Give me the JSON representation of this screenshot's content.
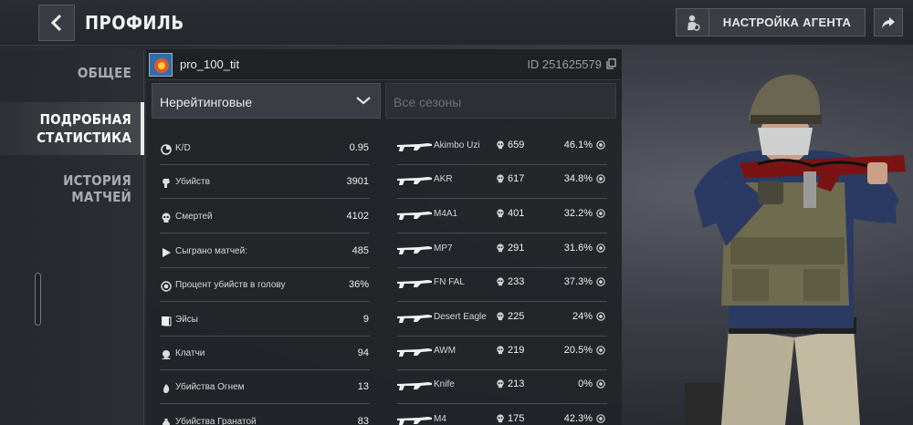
{
  "header": {
    "title": "ПРОФИЛЬ",
    "agent_button": "НАСТРОЙКА АГЕНТА"
  },
  "sidebar": {
    "items": [
      {
        "label": "ОБЩЕЕ",
        "active": false
      },
      {
        "label": "ПОДРОБНАЯ СТАТИСТИКА",
        "active": true
      },
      {
        "label": "ИСТОРИЯ МАТЧЕЙ",
        "active": false
      }
    ]
  },
  "profile": {
    "username": "pro_100_tit",
    "id": "ID 251625579"
  },
  "filters": {
    "mode": "Нерейтинговые",
    "season_placeholder": "Все сезоны"
  },
  "stats": [
    {
      "icon": "kd-icon",
      "label": "K/D",
      "value": "0.95"
    },
    {
      "icon": "kills-icon",
      "label": "Убийств",
      "value": "3901"
    },
    {
      "icon": "skull-icon",
      "label": "Смертей",
      "value": "4102"
    },
    {
      "icon": "play-icon",
      "label": "Сыграно матчей:",
      "value": "485"
    },
    {
      "icon": "headshot-icon",
      "label": "Процент убийств в голову",
      "value": "36%"
    },
    {
      "icon": "ace-icon",
      "label": "Эйсы",
      "value": "9"
    },
    {
      "icon": "clutch-icon",
      "label": "Клатчи",
      "value": "94"
    },
    {
      "icon": "fire-icon",
      "label": "Убийства Огнем",
      "value": "13"
    },
    {
      "icon": "grenade-icon",
      "label": "Убийства Гранатой",
      "value": "83"
    }
  ],
  "weapons": [
    {
      "name": "Akimbo Uzi",
      "kills": "659",
      "headshot": "46.1%"
    },
    {
      "name": "AKR",
      "kills": "617",
      "headshot": "34.8%"
    },
    {
      "name": "M4A1",
      "kills": "401",
      "headshot": "32.2%"
    },
    {
      "name": "MP7",
      "kills": "291",
      "headshot": "31.6%"
    },
    {
      "name": "FN FAL",
      "kills": "233",
      "headshot": "37.3%"
    },
    {
      "name": "Desert Eagle",
      "kills": "225",
      "headshot": "24%"
    },
    {
      "name": "AWM",
      "kills": "219",
      "headshot": "20.5%"
    },
    {
      "name": "Knife",
      "kills": "213",
      "headshot": "0%"
    },
    {
      "name": "M4",
      "kills": "175",
      "headshot": "42.3%"
    }
  ]
}
